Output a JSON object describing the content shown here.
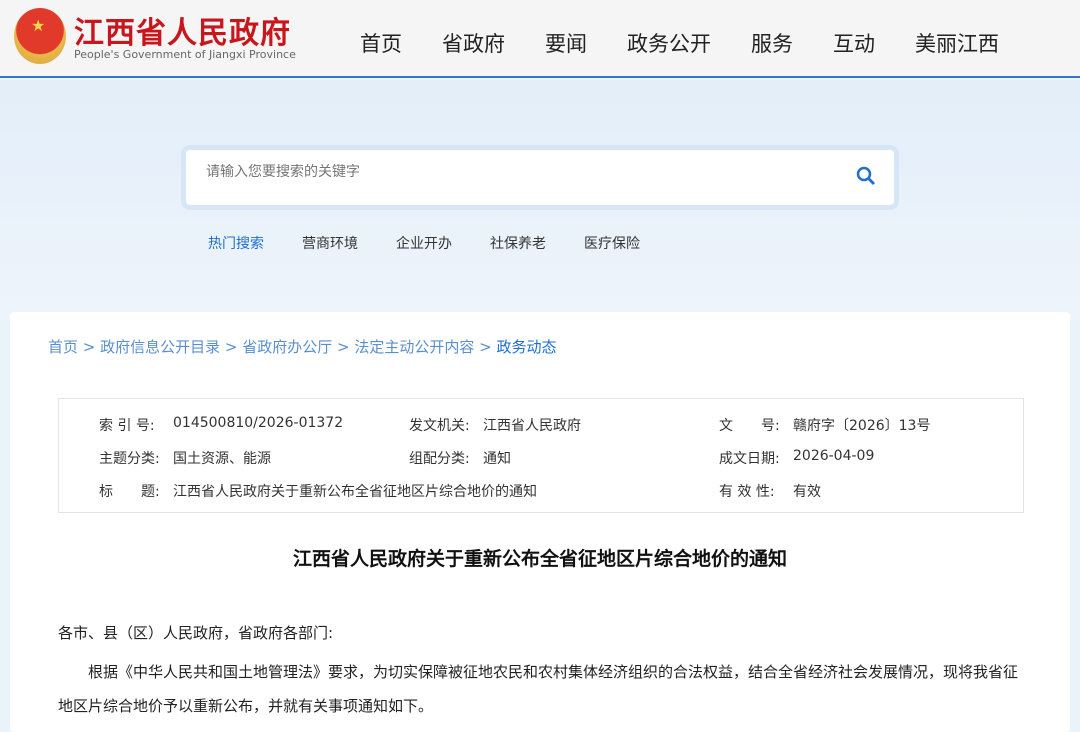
{
  "header": {
    "title": "江西省人民政府",
    "subtitle": "People's Government of Jiangxi Province",
    "nav": [
      "首页",
      "省政府",
      "要闻",
      "政务公开",
      "服务",
      "互动",
      "美丽江西"
    ]
  },
  "search": {
    "placeholder": "请输入您要搜索的关键字",
    "hot": [
      "热门搜索",
      "营商环境",
      "企业开办",
      "社保养老",
      "医疗保险"
    ]
  },
  "breadcrumb": [
    "首页",
    "政府信息公开目录",
    "省政府办公厅",
    "法定主动公开内容",
    "政务动态"
  ],
  "meta": {
    "index_label": "索 引 号:",
    "index": "014500810/2026-01372",
    "issuer_label": "发文机关:",
    "issuer": "江西省人民政府",
    "docno_label": "文　　号:",
    "docno": "赣府字〔2026〕13号",
    "topic_label": "主题分类:",
    "topic": "国土资源、能源",
    "cat_label": "组配分类:",
    "cat": "通知",
    "date_label": "成文日期:",
    "date": "2026-04-09",
    "title_label": "标　　题:",
    "title": "江西省人民政府关于重新公布全省征地区片综合地价的通知",
    "valid_label": "有 效 性:",
    "valid": "有效"
  },
  "article": {
    "title": "江西省人民政府关于重新公布全省征地区片综合地价的通知",
    "greeting": "各市、县（区）人民政府，省政府各部门:",
    "para1": "根据《中华人民共和国土地管理法》要求，为切实保障被征地农民和农村集体经济组织的合法权益，结合全省经济社会发展情况，现将我省征地区片综合地价予以重新公布，并就有关事项通知如下。"
  }
}
